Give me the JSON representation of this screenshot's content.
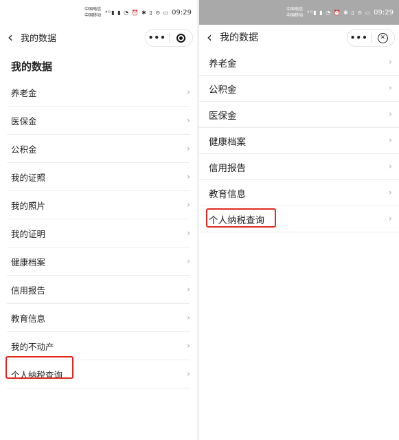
{
  "status": {
    "carrier_top": "中国电信",
    "carrier_bottom": "中国移动",
    "icons": "⁴ᴳ▮ ▮ ◔ ⏰ ✱ ▯ ⊙ ▭",
    "battery": "78",
    "time": "09:29"
  },
  "left": {
    "nav_title": "我的数据",
    "heading": "我的数据",
    "items": [
      "养老金",
      "医保金",
      "公积金",
      "我的证照",
      "我的照片",
      "我的证明",
      "健康档案",
      "信用报告",
      "教育信息",
      "我的不动产",
      "个人纳税查询"
    ]
  },
  "right": {
    "nav_title": "我的数据",
    "items": [
      "养老金",
      "公积金",
      "医保金",
      "健康档案",
      "信用报告",
      "教育信息",
      "个人纳税查询"
    ]
  },
  "icons": {
    "back": "chevron-left-icon",
    "more": "more-dots-icon",
    "target": "target-icon",
    "close": "close-circle-icon",
    "item_arrow": "chevron-right-icon"
  },
  "colors": {
    "highlight": "#e0281e",
    "status_bar_right": "#a9a9a9"
  }
}
